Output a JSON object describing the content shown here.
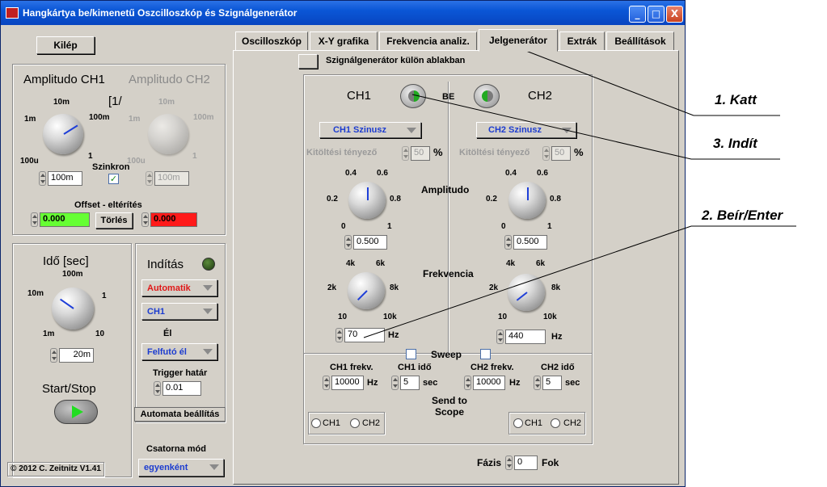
{
  "window": {
    "title": "Hangkártya be/kimenetű Oszcilloszkóp és Szignálgenerátor",
    "btn_min": "_",
    "btn_max": "□",
    "btn_close": "X"
  },
  "left": {
    "exit_label": "Kilép",
    "amp_ch1": "Amplitudo CH1",
    "amp_ch2": "Amplitudo CH2",
    "amp_unit": "[1/",
    "amp_ticks": [
      "10m",
      "1m",
      "100m",
      "100u",
      "1"
    ],
    "amp_ch1_value": "100m",
    "amp_ch2_value": "100m",
    "sync_label": "Szinkron",
    "sync_checked": true,
    "offset_label": "Offset - eltérítés",
    "offset_ch1": "0.000",
    "offset_ch2": "0.000",
    "clear_label": "Törlés",
    "time_label": "Idő [sec]",
    "time_ticks": [
      "100m",
      "10m",
      "1",
      "1m",
      "10"
    ],
    "time_value": "20m",
    "start_stop_label": "Start/Stop",
    "copyright": "© 2012  C. Zeitnitz V1.41",
    "trigger": {
      "start_label": "Indítás",
      "mode_value": "Automatik",
      "channel_value": "CH1",
      "edge_label": "Él",
      "edge_value": "Felfutó él",
      "threshold_label": "Trigger határ",
      "threshold_value": "0.01",
      "auto_setup_label": "Automata beállítás",
      "channel_mode_label": "Csatorna mód",
      "channel_mode_value": "egyenként"
    }
  },
  "tabs": [
    {
      "label": "Oscilloszkóp"
    },
    {
      "label": "X-Y grafika"
    },
    {
      "label": "Frekvencia analiz."
    },
    {
      "label": "Jelgenerátor"
    },
    {
      "label": "Extrák"
    },
    {
      "label": "Beállítások"
    }
  ],
  "active_tab": "Jelgenerátor",
  "gen": {
    "separate_window_label": "Szignálgenerátor külön ablakban",
    "ch1_label": "CH1",
    "ch2_label": "CH2",
    "on_label": "BE",
    "ch1_wave": "CH1 Szinusz",
    "ch2_wave": "CH2 Szinusz",
    "duty_label": "Kitöltési tényező",
    "duty_ch1": "50",
    "duty_ch2": "50",
    "percent": "%",
    "amplitude_label": "Amplitudo",
    "amp_ticks": [
      "0.4",
      "0.6",
      "0.2",
      "0.8",
      "0",
      "1"
    ],
    "amp_ch1": "0.500",
    "amp_ch2": "0.500",
    "freq_label": "Frekvencia",
    "freq_ticks": [
      "4k",
      "6k",
      "2k",
      "8k",
      "10",
      "10k"
    ],
    "freq_ch1": "70",
    "freq_ch2": "440",
    "hz": "Hz",
    "sweep_label": "Sweep",
    "ch1_freq_label": "CH1 frekv.",
    "ch1_time_label": "CH1 idő",
    "ch2_freq_label": "CH2 frekv.",
    "ch2_time_label": "CH2 idő",
    "ch1_sweep_freq": "10000",
    "ch1_sweep_time": "5",
    "ch2_sweep_freq": "10000",
    "ch2_sweep_time": "5",
    "sec": "sec",
    "send_to_scope": "Send to Scope",
    "radio_ch1": "CH1",
    "radio_ch2": "CH2",
    "phase_label": "Fázis",
    "phase_value": "0",
    "phase_unit": "Fok"
  },
  "annotations": {
    "step1": "1. Katt",
    "step2": "2. Beír/Enter",
    "step3": "3. Indít"
  },
  "colors": {
    "titlebar": "#0a56d6",
    "ring_text_red": "#e01818",
    "ring_text_blue": "#1c3cd0",
    "offset_green": "#66ff33",
    "offset_red": "#ff1a1a",
    "led_green": "#22aa22"
  }
}
